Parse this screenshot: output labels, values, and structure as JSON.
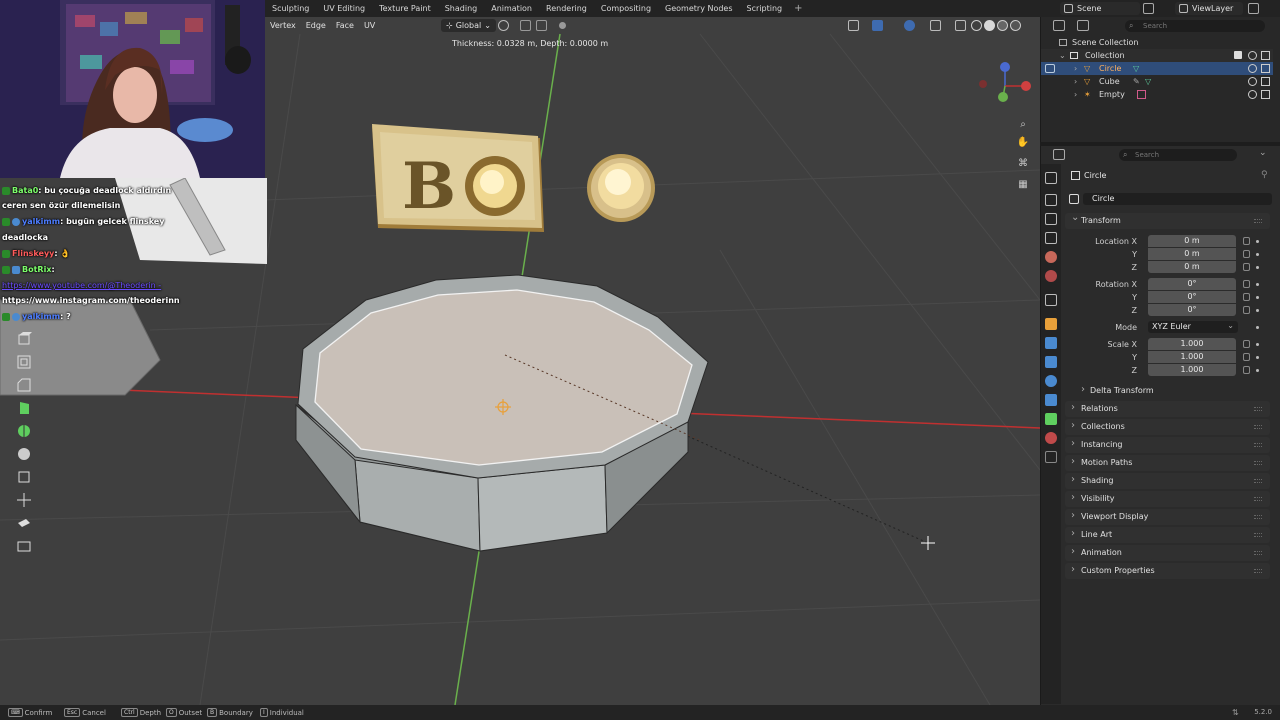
{
  "topbar": {
    "workspace_tabs": [
      "Sculpting",
      "UV Editing",
      "Texture Paint",
      "Shading",
      "Animation",
      "Rendering",
      "Compositing",
      "Geometry Nodes",
      "Scripting"
    ],
    "add_tab": "+",
    "scene": "Scene",
    "view_layer": "ViewLayer"
  },
  "viewport": {
    "menus": [
      "Vertex",
      "Edge",
      "Face",
      "UV"
    ],
    "orientation": "Global",
    "operator_info": "Thickness: 0.0328 m, Depth:  0.0000 m",
    "gizmo_axes": [
      "X",
      "Y",
      "Z"
    ],
    "navigation_icons": [
      "zoom-icon",
      "hand-icon",
      "camera-icon",
      "grid-icon"
    ],
    "tool_icons": [
      "extrude-icon",
      "inset-icon",
      "bevel-icon",
      "loopcut-icon",
      "knife-icon",
      "polybuild-icon",
      "spin-icon",
      "smooth-icon",
      "edge-slide-icon",
      "shrink-icon",
      "shear-icon",
      "rip-icon"
    ]
  },
  "webcam": {
    "chat": [
      {
        "user": "Bata0",
        "message": ": bu çocuğa deadlock aldırdın"
      },
      {
        "user": "",
        "message": "ceren sen özür dilemelisin"
      },
      {
        "user": "yalkimm",
        "message": ": bugün gelcek flinskey"
      },
      {
        "user": "",
        "message": "deadlocka"
      },
      {
        "user": "Flinskeyy",
        "message": ": 👌"
      },
      {
        "user": "BotRix",
        "message": ":"
      },
      {
        "user": "",
        "message": "https://www.youtube.com/@Theoderin -"
      },
      {
        "user": "",
        "message": "https://www.instagram.com/theoderinn"
      },
      {
        "user": "yalkimm",
        "message": ": ?"
      }
    ]
  },
  "outliner": {
    "search_placeholder": "Search",
    "scene_collection": "Scene Collection",
    "collection": "Collection",
    "items": [
      {
        "name": "Circle",
        "selected": true
      },
      {
        "name": "Cube",
        "selected": false
      },
      {
        "name": "Empty",
        "selected": false
      }
    ]
  },
  "properties": {
    "search_placeholder": "Search",
    "object_name": "Circle",
    "object_field": "Circle",
    "transform_header": "Transform",
    "location_label": "Location X",
    "rotation_label": "Rotation X",
    "scale_label": "Scale X",
    "axis_y": "Y",
    "axis_z": "Z",
    "location": [
      "0 m",
      "0 m",
      "0 m"
    ],
    "rotation": [
      "0°",
      "0°",
      "0°"
    ],
    "scale": [
      "1.000",
      "1.000",
      "1.000"
    ],
    "mode_label": "Mode",
    "mode_value": "XYZ Euler",
    "delta_transform": "Delta Transform",
    "panels": [
      "Relations",
      "Collections",
      "Instancing",
      "Motion Paths",
      "Shading",
      "Visibility",
      "Viewport Display",
      "Line Art",
      "Animation",
      "Custom Properties"
    ]
  },
  "statusbar": {
    "items": [
      {
        "key": "⌨",
        "label": "Confirm"
      },
      {
        "key": "Esc",
        "label": "Cancel"
      },
      {
        "key": "Ctrl",
        "label": "Depth"
      },
      {
        "key": "O",
        "label": "Outset"
      },
      {
        "key": "B",
        "label": "Boundary"
      },
      {
        "key": "I",
        "label": "Individual"
      }
    ],
    "version": "5.2.0"
  },
  "colors": {
    "viewport_bg": "#3f3f3f",
    "selection_blue": "#2f4d7a",
    "x_axis": "#c03030",
    "y_axis": "#6ab04c",
    "accent_orange": "#e8a03a"
  }
}
